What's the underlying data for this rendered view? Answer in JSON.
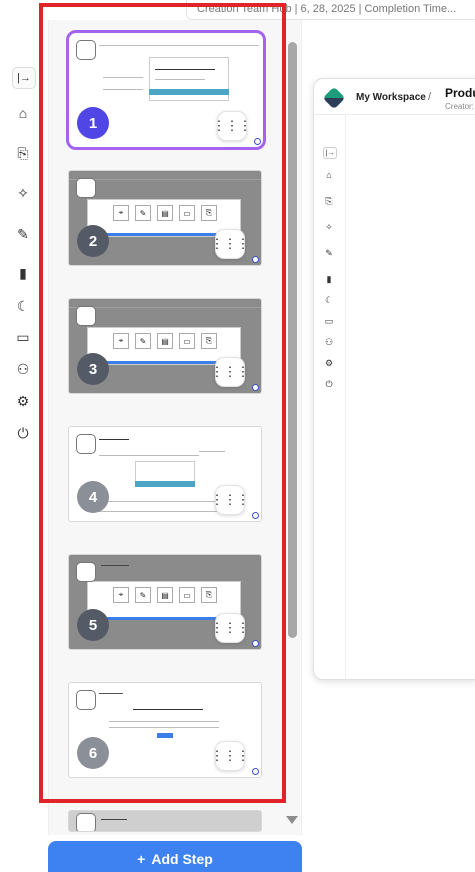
{
  "header": {
    "caption": "Creation Team Hub | 6, 28, 2025 | Completion Time..."
  },
  "rail": {
    "items": [
      {
        "name": "expand-icon",
        "glyph": "|→"
      },
      {
        "name": "home-icon",
        "glyph": "⌂"
      },
      {
        "name": "import-icon",
        "glyph": "⎘"
      },
      {
        "name": "sparkle-icon",
        "glyph": "✧"
      },
      {
        "name": "brush-icon",
        "glyph": "✎"
      },
      {
        "name": "chart-icon",
        "glyph": "▮"
      },
      {
        "name": "moon-icon",
        "glyph": "☾"
      },
      {
        "name": "book-icon",
        "glyph": "▭"
      },
      {
        "name": "add-user-icon",
        "glyph": "⚇"
      },
      {
        "name": "settings-icon",
        "glyph": "⚙"
      },
      {
        "name": "power-icon",
        "glyph": "⏻"
      }
    ]
  },
  "steps": [
    {
      "number": "1",
      "selected": true,
      "badge_color": "#4f46e5",
      "style": "light"
    },
    {
      "number": "2",
      "selected": false,
      "badge_color": "#555b66",
      "style": "gray"
    },
    {
      "number": "3",
      "selected": false,
      "badge_color": "#555b66",
      "style": "gray"
    },
    {
      "number": "4",
      "selected": false,
      "badge_color": "#8a8f98",
      "style": "light"
    },
    {
      "number": "5",
      "selected": false,
      "badge_color": "#555b66",
      "style": "gray"
    },
    {
      "number": "6",
      "selected": false,
      "badge_color": "#8a8f98",
      "style": "light"
    }
  ],
  "grid_button_glyph": "⋮⋮⋮",
  "add_step": {
    "plus": "+",
    "label": "Add Step"
  },
  "preview": {
    "workspace": "My Workspace",
    "separator": "/",
    "title": "Produ",
    "creator": "Creator: T",
    "rail_glyphs": [
      "|→",
      "⌂",
      "⎘",
      "✧",
      "✎",
      "▮",
      "☾",
      "▭",
      "⚇",
      "⚙",
      "⏻"
    ]
  },
  "colors": {
    "accent": "#3d82f0",
    "selected_border": "#a463ef",
    "highlight_frame": "#e0242a"
  }
}
